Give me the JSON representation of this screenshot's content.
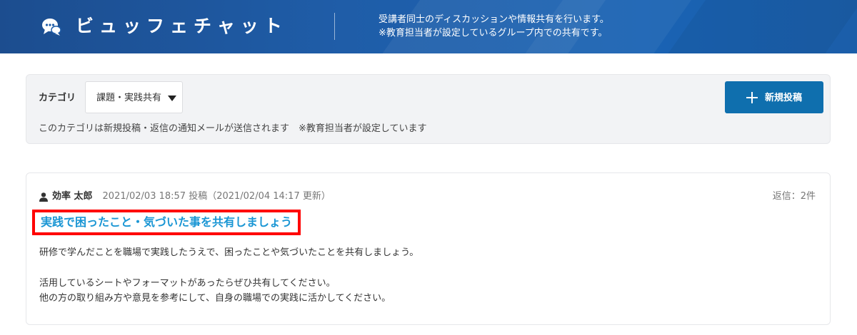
{
  "header": {
    "logo_icon": "chat-bubbles-icon",
    "title": "ビュッフェチャット",
    "description_line1": "受講者同士のディスカッションや情報共有を行います。",
    "description_line2": "※教育担当者が設定しているグループ内での共有です。"
  },
  "category": {
    "label": "カテゴリ",
    "selected": "課題・実践共有",
    "note": "このカテゴリは新規投稿・返信の通知メールが送信されます　※教育担当者が設定しています",
    "new_post_icon": "plus-icon",
    "new_post_label": "新規投稿"
  },
  "post": {
    "author_icon": "user-icon",
    "author": "効率 太郎",
    "meta": "2021/02/03 18:57 投稿（2021/02/04 14:17 更新）",
    "reply_count": "返信：2件",
    "title": "実践で困ったこと・気づいた事を共有しましょう",
    "body_line1": "研修で学んだことを職場で実践したうえで、困ったことや気づいたことを共有しましょう。",
    "body_line2": "活用しているシートやフォーマットがあったらぜひ共有してください。",
    "body_line3": "他の方の取り組み方や意見を参考にして、自身の職場での実践に活かしてください。"
  },
  "colors": {
    "header_blue": "#1f5da8",
    "button_blue": "#0f6fae",
    "title_link": "#1a96d4",
    "highlight_border": "#ff0000",
    "panel_bg": "#f2f3f5"
  }
}
